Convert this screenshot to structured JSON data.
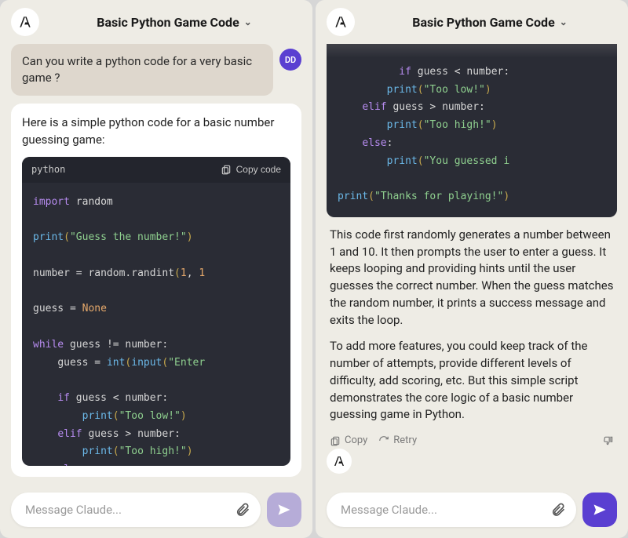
{
  "left": {
    "title": "Basic Python Game Code",
    "user_avatar": "DD",
    "user_message": "Can you write a python code for a very basic game ?",
    "assistant_intro": "Here is a simple python code for a basic number guessing game:",
    "code_lang": "python",
    "copy_label": "Copy code",
    "composer_placeholder": "Message Claude..."
  },
  "right": {
    "title": "Basic Python Game Code",
    "explain1": "This code first randomly generates a number between 1 and 10. It then prompts the user to enter a guess. It keeps looping and providing hints until the user guesses the correct number. When the guess matches the random number, it prints a success message and exits the loop.",
    "explain2": "To add more features, you could keep track of the number of attempts, provide different levels of difficulty, add scoring, etc. But this simple script demonstrates the core logic of a basic number guessing game in Python.",
    "copy_label": "Copy",
    "retry_label": "Retry",
    "composer_placeholder": "Message Claude..."
  },
  "code": {
    "import": "import",
    "random": "random",
    "print": "print",
    "guess_prompt": "\"Guess the number!\"",
    "number": "number",
    "eq": "=",
    "randint": "random.randint",
    "lp": "(",
    "rp": ")",
    "one": "1",
    "comma": ", ",
    "ten": "1",
    "guess": "guess",
    "none": "None",
    "while": "while",
    "neq": "!=",
    "colon": ":",
    "int": "int",
    "input": "input",
    "enter": "\"Enter",
    "if": "if",
    "lt": "<",
    "too_low": "\"Too low!\"",
    "elif": "elif",
    "gt": ">",
    "too_high": "\"Too high!\"",
    "else": "else",
    "you_guessed": "\"You guessed i",
    "thanks": "\"Thanks for playing!\""
  }
}
